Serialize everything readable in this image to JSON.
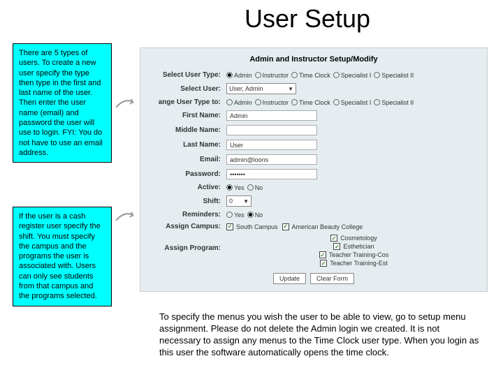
{
  "title": "User Setup",
  "callout1": "There are 5 types of users. To create a new user specify the type then type in the first and last name of the user. Then enter the user name (email) and password the user will use to login. FYI: You do not have to use an email address.",
  "callout2": "If the user is a cash register user specify the shift. You must specify the campus and the programs the user is associated with. Users can only see students from that campus and the programs selected.",
  "panel": {
    "heading": "Admin and Instructor Setup/Modify",
    "rows": {
      "selectUserType": {
        "label": "Select User Type:",
        "options": [
          "Admin",
          "Instructor",
          "Time Clock",
          "Specialist I",
          "Specialist II"
        ],
        "selected": 0
      },
      "selectUser": {
        "label": "Select User:",
        "value": "User, Admin"
      },
      "changeType": {
        "label": "ange User Type to:",
        "options": [
          "Admin",
          "Instructor",
          "Time Clock",
          "Specialist I",
          "Specialist II"
        ],
        "selected": -1
      },
      "firstName": {
        "label": "First Name:",
        "value": "Admin"
      },
      "middleName": {
        "label": "Middle Name:",
        "value": ""
      },
      "lastName": {
        "label": "Last Name:",
        "value": "User"
      },
      "email": {
        "label": "Email:",
        "value": "admin@loons"
      },
      "password": {
        "label": "Password:",
        "value": "•••••••"
      },
      "active": {
        "label": "Active:",
        "options": [
          "Yes",
          "No"
        ],
        "selected": 0
      },
      "shift": {
        "label": "Shift:",
        "value": "0"
      },
      "reminders": {
        "label": "Reminders:",
        "options": [
          "Yes",
          "No"
        ],
        "selected": 1
      },
      "assignCampus": {
        "label": "Assign Campus:",
        "options": [
          "South Campus",
          "American Beauty College"
        ],
        "checked": [
          true,
          true
        ]
      },
      "assignProgram": {
        "label": "Assign Program:",
        "items": [
          {
            "label": "Cosmetology",
            "checked": true
          },
          {
            "label": "Esthetician",
            "checked": true
          },
          {
            "label": "Teacher Training-Cos",
            "checked": true
          },
          {
            "label": "Teacher Training-Est",
            "checked": true
          }
        ]
      }
    },
    "buttons": {
      "update": "Update",
      "clear": "Clear Form"
    }
  },
  "footnote": "To specify the menus you wish the user to be able to view, go to setup menu assignment. Please do not delete the Admin login we created. It is not necessary to assign any menus to the Time Clock user type. When you login as this user the software automatically opens the time clock."
}
